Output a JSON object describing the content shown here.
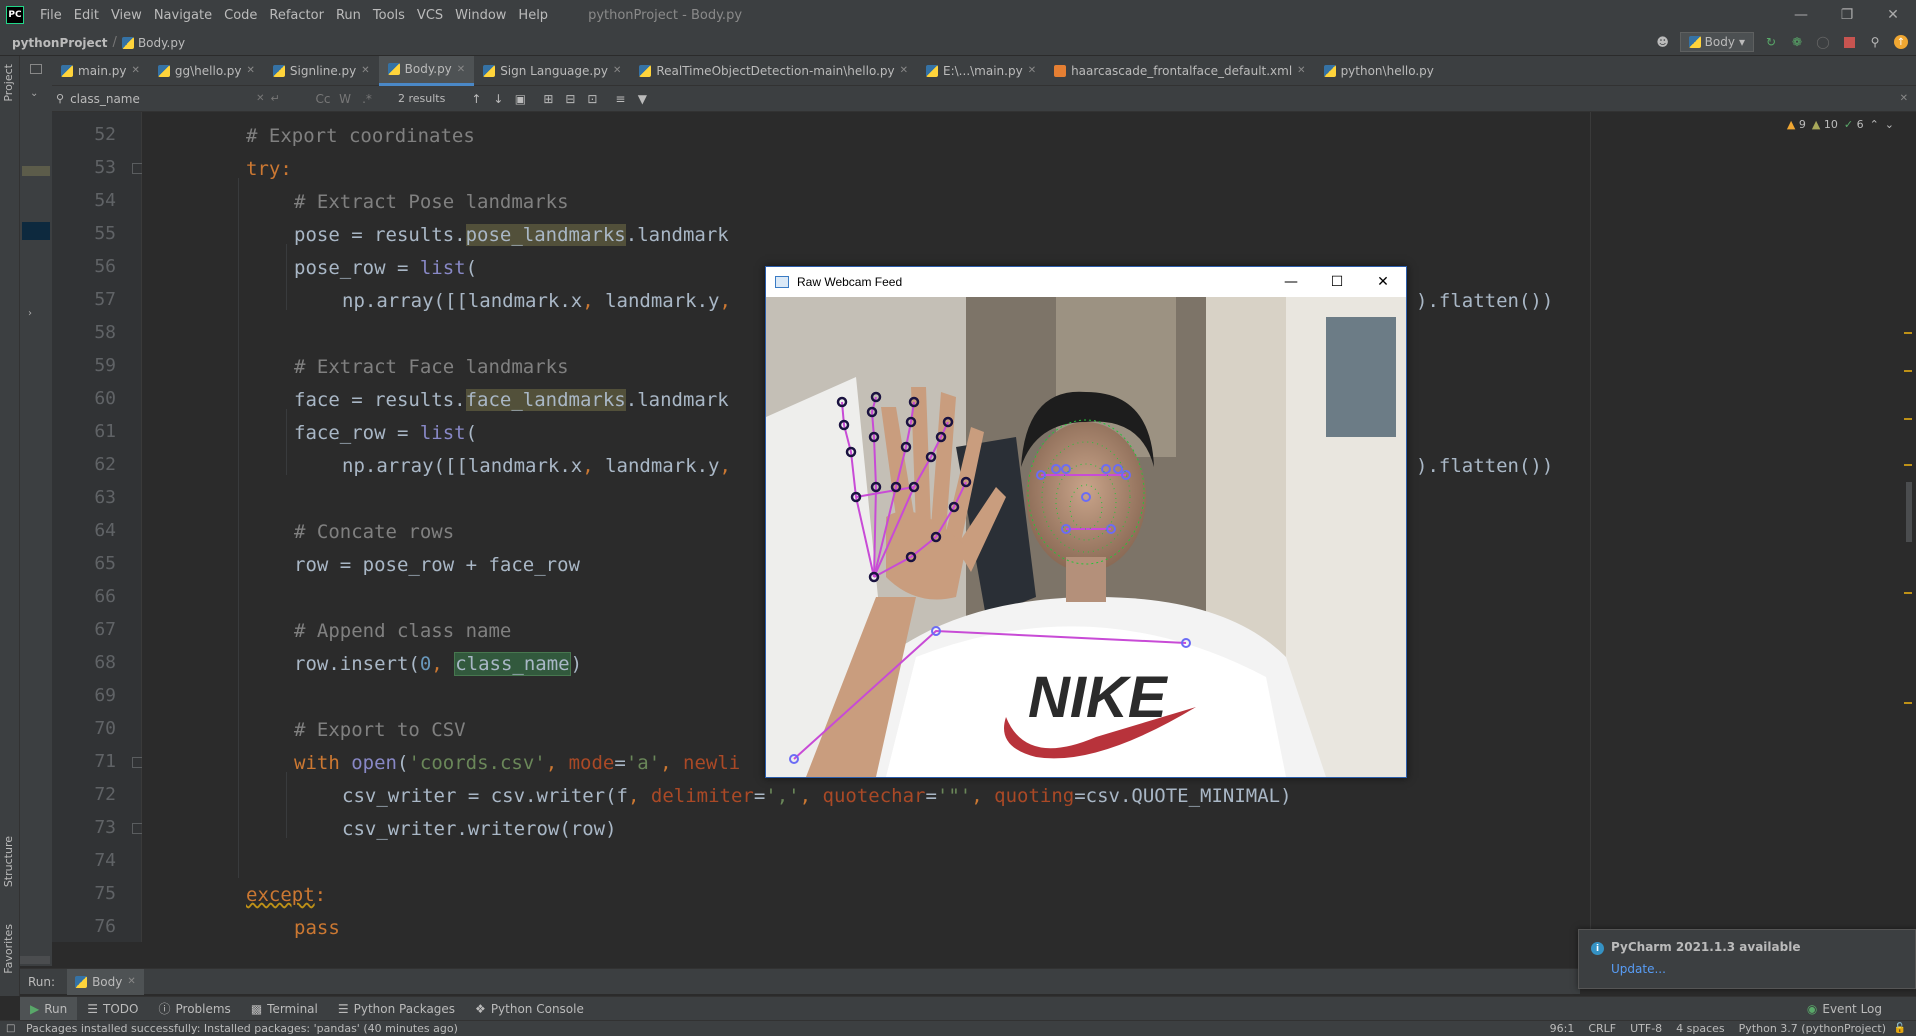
{
  "app": {
    "logo": "PC",
    "window_title": "pythonProject - Body.py",
    "menu": [
      "File",
      "Edit",
      "View",
      "Navigate",
      "Code",
      "Refactor",
      "Run",
      "Tools",
      "VCS",
      "Window",
      "Help"
    ]
  },
  "navbar": {
    "project": "pythonProject",
    "file": "Body.py",
    "run_config": "Body"
  },
  "left_stripe": {
    "project_label": "Project",
    "structure_label": "Structure",
    "favorites_label": "Favorites"
  },
  "tabs": [
    {
      "label": "main.py",
      "active": false
    },
    {
      "label": "gg\\hello.py",
      "active": false
    },
    {
      "label": "Signline.py",
      "active": false
    },
    {
      "label": "Body.py",
      "active": true
    },
    {
      "label": "Sign Language.py",
      "active": false
    },
    {
      "label": "RealTimeObjectDetection-main\\hello.py",
      "active": false
    },
    {
      "label": "E:\\...\\main.py",
      "active": false
    },
    {
      "label": "haarcascade_frontalface_default.xml",
      "active": false
    },
    {
      "label": "python\\hello.py",
      "active": false
    }
  ],
  "search": {
    "query": "class_name",
    "results": "2 results",
    "match_case": "Cc",
    "words": "W",
    "regex": ".*"
  },
  "inspection": {
    "warnings": "9",
    "weak_warnings": "10",
    "ok": "6"
  },
  "editor": {
    "line_numbers": [
      "52",
      "53",
      "54",
      "55",
      "56",
      "57",
      "58",
      "59",
      "60",
      "61",
      "62",
      "63",
      "64",
      "65",
      "66",
      "67",
      "68",
      "69",
      "70",
      "71",
      "72",
      "73",
      "74",
      "75",
      "76"
    ],
    "code": {
      "l52": "# Export coordinates",
      "l53": "try",
      "l54": "# Extract Pose landmarks",
      "l55a": "pose = results.",
      "l55b": "pose_landmarks",
      "l55c": ".landmark",
      "l56a": "pose_row = ",
      "l56b": "list",
      "l57a": "np.array([[landmark.x",
      "l57b": "landmark.y",
      "l57c": ").flatten())",
      "l59": "# Extract Face landmarks",
      "l60a": "face = results.",
      "l60b": "face_landmarks",
      "l60c": ".landmark",
      "l61a": "face_row = ",
      "l61b": "list",
      "l62a": "np.array([[landmark.x",
      "l62b": "landmark.y",
      "l62c": ").flatten())",
      "l64": "# Concate rows",
      "l65": "row = pose_row + face_row",
      "l67": "# Append class name",
      "l68a": "row.insert(",
      "l68b": "0",
      "l68c": "class_name",
      "l70": "# Export to CSV",
      "l71a": "with",
      "l71b": "open",
      "l71c": "'coords.csv'",
      "l71d": "mode",
      "l71e": "'a'",
      "l71f": "newli",
      "l72a": "csv_writer = csv.writer(f",
      "l72b": "delimiter",
      "l72c": "','",
      "l72d": "quotechar",
      "l72e": "'\"'",
      "l72f": "quoting",
      "l72g": "=csv.QUOTE_MINIMAL)",
      "l73": "csv_writer.writerow(row)",
      "l75": "except",
      "l76": "pass"
    }
  },
  "webcam": {
    "title": "Raw Webcam Feed",
    "shirt_text": "NIKE"
  },
  "run_bar": {
    "label": "Run:",
    "tab": "Body"
  },
  "tool_tabs": [
    "Run",
    "TODO",
    "Problems",
    "Terminal",
    "Python Packages",
    "Python Console"
  ],
  "event_log": "Event Log",
  "notification": {
    "title": "PyCharm 2021.1.3 available",
    "link": "Update..."
  },
  "status": {
    "message": "Packages installed successfully: Installed packages: 'pandas' (40 minutes ago)",
    "position": "96:1",
    "line_sep": "CRLF",
    "encoding": "UTF-8",
    "indent": "4 spaces",
    "interpreter": "Python 3.7 (pythonProject)"
  }
}
